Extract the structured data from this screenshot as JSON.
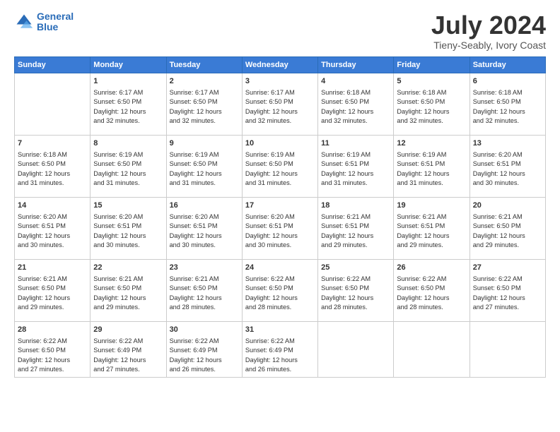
{
  "header": {
    "logo": {
      "line1": "General",
      "line2": "Blue"
    },
    "title": "July 2024",
    "subtitle": "Tieny-Seably, Ivory Coast"
  },
  "weekdays": [
    "Sunday",
    "Monday",
    "Tuesday",
    "Wednesday",
    "Thursday",
    "Friday",
    "Saturday"
  ],
  "rows": [
    [
      {
        "day": "",
        "info": ""
      },
      {
        "day": "1",
        "info": "Sunrise: 6:17 AM\nSunset: 6:50 PM\nDaylight: 12 hours\nand 32 minutes."
      },
      {
        "day": "2",
        "info": "Sunrise: 6:17 AM\nSunset: 6:50 PM\nDaylight: 12 hours\nand 32 minutes."
      },
      {
        "day": "3",
        "info": "Sunrise: 6:17 AM\nSunset: 6:50 PM\nDaylight: 12 hours\nand 32 minutes."
      },
      {
        "day": "4",
        "info": "Sunrise: 6:18 AM\nSunset: 6:50 PM\nDaylight: 12 hours\nand 32 minutes."
      },
      {
        "day": "5",
        "info": "Sunrise: 6:18 AM\nSunset: 6:50 PM\nDaylight: 12 hours\nand 32 minutes."
      },
      {
        "day": "6",
        "info": "Sunrise: 6:18 AM\nSunset: 6:50 PM\nDaylight: 12 hours\nand 32 minutes."
      }
    ],
    [
      {
        "day": "7",
        "info": "Sunrise: 6:18 AM\nSunset: 6:50 PM\nDaylight: 12 hours\nand 31 minutes."
      },
      {
        "day": "8",
        "info": "Sunrise: 6:19 AM\nSunset: 6:50 PM\nDaylight: 12 hours\nand 31 minutes."
      },
      {
        "day": "9",
        "info": "Sunrise: 6:19 AM\nSunset: 6:50 PM\nDaylight: 12 hours\nand 31 minutes."
      },
      {
        "day": "10",
        "info": "Sunrise: 6:19 AM\nSunset: 6:50 PM\nDaylight: 12 hours\nand 31 minutes."
      },
      {
        "day": "11",
        "info": "Sunrise: 6:19 AM\nSunset: 6:51 PM\nDaylight: 12 hours\nand 31 minutes."
      },
      {
        "day": "12",
        "info": "Sunrise: 6:19 AM\nSunset: 6:51 PM\nDaylight: 12 hours\nand 31 minutes."
      },
      {
        "day": "13",
        "info": "Sunrise: 6:20 AM\nSunset: 6:51 PM\nDaylight: 12 hours\nand 30 minutes."
      }
    ],
    [
      {
        "day": "14",
        "info": "Sunrise: 6:20 AM\nSunset: 6:51 PM\nDaylight: 12 hours\nand 30 minutes."
      },
      {
        "day": "15",
        "info": "Sunrise: 6:20 AM\nSunset: 6:51 PM\nDaylight: 12 hours\nand 30 minutes."
      },
      {
        "day": "16",
        "info": "Sunrise: 6:20 AM\nSunset: 6:51 PM\nDaylight: 12 hours\nand 30 minutes."
      },
      {
        "day": "17",
        "info": "Sunrise: 6:20 AM\nSunset: 6:51 PM\nDaylight: 12 hours\nand 30 minutes."
      },
      {
        "day": "18",
        "info": "Sunrise: 6:21 AM\nSunset: 6:51 PM\nDaylight: 12 hours\nand 29 minutes."
      },
      {
        "day": "19",
        "info": "Sunrise: 6:21 AM\nSunset: 6:51 PM\nDaylight: 12 hours\nand 29 minutes."
      },
      {
        "day": "20",
        "info": "Sunrise: 6:21 AM\nSunset: 6:50 PM\nDaylight: 12 hours\nand 29 minutes."
      }
    ],
    [
      {
        "day": "21",
        "info": "Sunrise: 6:21 AM\nSunset: 6:50 PM\nDaylight: 12 hours\nand 29 minutes."
      },
      {
        "day": "22",
        "info": "Sunrise: 6:21 AM\nSunset: 6:50 PM\nDaylight: 12 hours\nand 29 minutes."
      },
      {
        "day": "23",
        "info": "Sunrise: 6:21 AM\nSunset: 6:50 PM\nDaylight: 12 hours\nand 28 minutes."
      },
      {
        "day": "24",
        "info": "Sunrise: 6:22 AM\nSunset: 6:50 PM\nDaylight: 12 hours\nand 28 minutes."
      },
      {
        "day": "25",
        "info": "Sunrise: 6:22 AM\nSunset: 6:50 PM\nDaylight: 12 hours\nand 28 minutes."
      },
      {
        "day": "26",
        "info": "Sunrise: 6:22 AM\nSunset: 6:50 PM\nDaylight: 12 hours\nand 28 minutes."
      },
      {
        "day": "27",
        "info": "Sunrise: 6:22 AM\nSunset: 6:50 PM\nDaylight: 12 hours\nand 27 minutes."
      }
    ],
    [
      {
        "day": "28",
        "info": "Sunrise: 6:22 AM\nSunset: 6:50 PM\nDaylight: 12 hours\nand 27 minutes."
      },
      {
        "day": "29",
        "info": "Sunrise: 6:22 AM\nSunset: 6:49 PM\nDaylight: 12 hours\nand 27 minutes."
      },
      {
        "day": "30",
        "info": "Sunrise: 6:22 AM\nSunset: 6:49 PM\nDaylight: 12 hours\nand 26 minutes."
      },
      {
        "day": "31",
        "info": "Sunrise: 6:22 AM\nSunset: 6:49 PM\nDaylight: 12 hours\nand 26 minutes."
      },
      {
        "day": "",
        "info": ""
      },
      {
        "day": "",
        "info": ""
      },
      {
        "day": "",
        "info": ""
      }
    ]
  ]
}
